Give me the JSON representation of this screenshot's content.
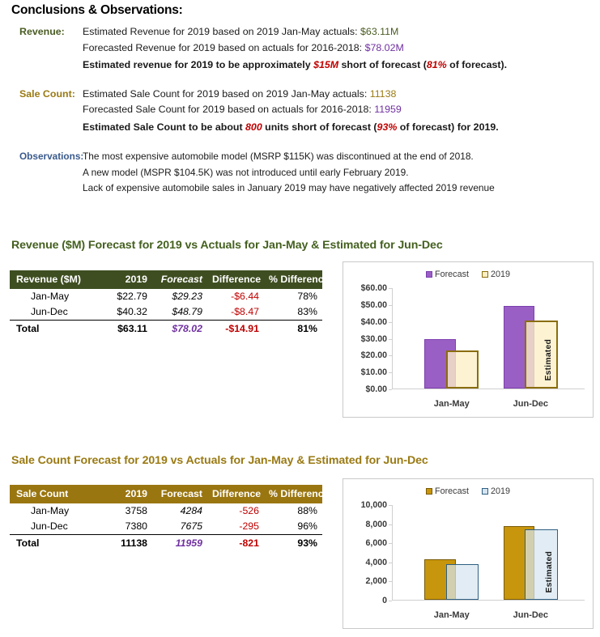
{
  "conclusions": {
    "heading": "Conclusions & Observations:",
    "groups": [
      {
        "label": "Revenue:",
        "lines": [
          {
            "pre": "Estimated Revenue for 2019 based on 2019 Jan-May actuals: ",
            "value": "$63.11M",
            "value_style": "green",
            "post": "",
            "bold": false
          },
          {
            "pre": "Forecasted Revenue for 2019 based on actuals for 2016-2018: ",
            "value": "$78.02M",
            "value_style": "purple",
            "post": "",
            "bold": false
          },
          {
            "pre": "Estimated revenue for 2019 to be approximately ",
            "value": "$15M",
            "value_style": "red-italic",
            "mid": " short of forecast (",
            "value2": "81%",
            "post": " of forecast).",
            "bold": true
          }
        ]
      },
      {
        "label": "Sale Count:",
        "lines": [
          {
            "pre": "Estimated Sale Count for 2019 based on 2019 Jan-May actuals: ",
            "value": "11138",
            "value_style": "gold",
            "post": "",
            "bold": false
          },
          {
            "pre": "Forecasted Sale Count for 2019 based on actuals for 2016-2018: ",
            "value": "11959",
            "value_style": "purple",
            "post": "",
            "bold": false
          },
          {
            "pre": "Estimated Sale Count to be about ",
            "value": "800",
            "value_style": "red-italic",
            "mid": " units short of forecast (",
            "value2": "93%",
            "post": " of forecast) for 2019.",
            "bold": true
          }
        ]
      },
      {
        "label": "Observations:",
        "lines": [
          {
            "pre": "The most expensive automobile model (MSRP $115K) was discontinued at the end of 2018.",
            "value": "",
            "post": "",
            "bold": false
          },
          {
            "pre": "A new model (MSPR $104.5K) was not introduced until early February 2019.",
            "value": "",
            "post": "",
            "bold": false
          },
          {
            "pre": "Lack of expensive automobile sales in January 2019 may have negatively affected 2019 revenue",
            "value": "",
            "post": "",
            "bold": false
          }
        ]
      }
    ]
  },
  "revenue_panel": {
    "title": "Revenue ($M) Forecast for 2019 vs Actuals for Jan-May & Estimated for Jun-Dec",
    "table": {
      "headers": [
        "Revenue ($M)",
        "2019",
        "Forecast",
        "Difference",
        "% Difference"
      ],
      "rows": [
        {
          "label": "Jan-May",
          "y2019": "$22.79",
          "forecast": "$29.23",
          "difference": "-$6.44",
          "pct": "78%"
        },
        {
          "label": "Jun-Dec",
          "y2019": "$40.32",
          "forecast": "$48.79",
          "difference": "-$8.47",
          "pct": "83%"
        }
      ],
      "total": {
        "label": "Total",
        "y2019": "$63.11",
        "forecast": "$78.02",
        "difference": "-$14.91",
        "pct": "81%"
      }
    }
  },
  "sale_panel": {
    "title": "Sale Count Forecast for 2019 vs Actuals for Jan-May & Estimated for Jun-Dec",
    "table": {
      "headers": [
        "Sale Count",
        "2019",
        "Forecast",
        "Difference",
        "% Difference"
      ],
      "rows": [
        {
          "label": "Jan-May",
          "y2019": "3758",
          "forecast": "4284",
          "difference": "-526",
          "pct": "88%"
        },
        {
          "label": "Jun-Dec",
          "y2019": "7380",
          "forecast": "7675",
          "difference": "-295",
          "pct": "96%"
        }
      ],
      "total": {
        "label": "Total",
        "y2019": "11138",
        "forecast": "11959",
        "difference": "-821",
        "pct": "93%"
      }
    }
  },
  "chart_data": [
    {
      "id": "revenue-chart",
      "type": "bar",
      "title": "",
      "categories": [
        "Jan-May",
        "Jun-Dec"
      ],
      "series": [
        {
          "name": "Forecast",
          "values": [
            29.23,
            48.79
          ],
          "color": "#9A5FC4",
          "border": "#7B3FAF"
        },
        {
          "name": "2019",
          "values": [
            22.79,
            40.32
          ],
          "color": "#FCEFC7",
          "border": "#8A6D0B"
        }
      ],
      "ylim": [
        0,
        60
      ],
      "yticks": [
        0,
        10,
        20,
        30,
        40,
        50,
        60
      ],
      "ytick_labels": [
        "$0.00",
        "$10.00",
        "$20.00",
        "$30.00",
        "$40.00",
        "$50.00",
        "$60.00"
      ],
      "xlabel": "",
      "ylabel": "",
      "grid": false,
      "legend_position": "top",
      "annotations": [
        {
          "text": "Estimated",
          "category": "Jun-Dec",
          "series": "2019",
          "orientation": "vertical"
        }
      ]
    },
    {
      "id": "sale-count-chart",
      "type": "bar",
      "title": "",
      "categories": [
        "Jan-May",
        "Jun-Dec"
      ],
      "series": [
        {
          "name": "Forecast",
          "values": [
            4284,
            7675
          ],
          "color": "#C8960C",
          "border": "#7A5A06"
        },
        {
          "name": "2019",
          "values": [
            3758,
            7380
          ],
          "color": "#D6E4F0",
          "border": "#2E5F82"
        }
      ],
      "ylim": [
        0,
        10000
      ],
      "yticks": [
        0,
        2000,
        4000,
        6000,
        8000,
        10000
      ],
      "ytick_labels": [
        "0",
        "2,000",
        "4,000",
        "6,000",
        "8,000",
        "10,000"
      ],
      "xlabel": "",
      "ylabel": "",
      "grid": false,
      "legend_position": "top",
      "annotations": [
        {
          "text": "Estimated",
          "category": "Jun-Dec",
          "series": "2019",
          "orientation": "vertical"
        }
      ]
    }
  ]
}
